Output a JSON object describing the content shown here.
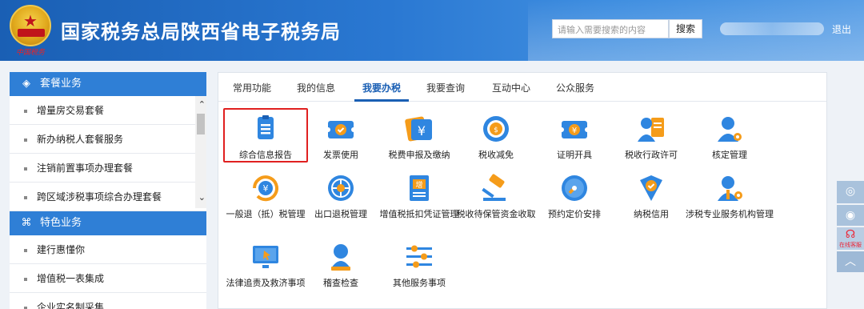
{
  "header": {
    "title": "国家税务总局陕西省电子税务局",
    "logo_text": "中国税务",
    "search_placeholder": "请输入需要搜索的内容",
    "search_button": "搜索",
    "logout": "退出"
  },
  "sidebar": {
    "section1": {
      "label": "套餐业务",
      "icon": "cube-icon"
    },
    "items1": [
      "增量房交易套餐",
      "新办纳税人套餐服务",
      "注销前置事项办理套餐",
      "跨区域涉税事项综合办理套餐"
    ],
    "section2": {
      "label": "特色业务",
      "icon": "grid-icon"
    },
    "items2": [
      "建行惠懂你",
      "增值税一表集成",
      "企业实名制采集"
    ]
  },
  "tabs": [
    {
      "label": "常用功能",
      "active": false
    },
    {
      "label": "我的信息",
      "active": false
    },
    {
      "label": "我要办税",
      "active": true
    },
    {
      "label": "我要查询",
      "active": false
    },
    {
      "label": "互动中心",
      "active": false
    },
    {
      "label": "公众服务",
      "active": false
    }
  ],
  "grid": [
    {
      "label": "综合信息报告",
      "icon": "report-icon"
    },
    {
      "label": "发票使用",
      "icon": "invoice-icon"
    },
    {
      "label": "税费申报及缴纳",
      "icon": "tax-payment-icon"
    },
    {
      "label": "税收减免",
      "icon": "tax-reduction-icon"
    },
    {
      "label": "证明开具",
      "icon": "certificate-icon"
    },
    {
      "label": "税收行政许可",
      "icon": "admin-permit-icon"
    },
    {
      "label": "核定管理",
      "icon": "verification-icon"
    },
    {
      "label": "一般退（抵）税管理",
      "icon": "refund-icon"
    },
    {
      "label": "出口退税管理",
      "icon": "export-refund-icon"
    },
    {
      "label": "增值税抵扣凭证管理",
      "icon": "vat-deduction-icon"
    },
    {
      "label": "税收待保管资金收取",
      "icon": "gavel-icon"
    },
    {
      "label": "预约定价安排",
      "icon": "pricing-icon"
    },
    {
      "label": "纳税信用",
      "icon": "credit-icon"
    },
    {
      "label": "涉税专业服务机构管理",
      "icon": "agency-icon"
    },
    {
      "label": "法律追责及救济事项",
      "icon": "legal-icon"
    },
    {
      "label": "稽查检查",
      "icon": "inspection-icon"
    },
    {
      "label": "其他服务事项",
      "icon": "other-services-icon"
    }
  ],
  "float_bar": {
    "online_service": "在线客服"
  },
  "colors": {
    "brand": "#1a5fb4",
    "accent": "#2f7fd6",
    "highlight": "#e02020",
    "icon_blue": "#2f86e0",
    "icon_orange": "#f59c1a"
  }
}
